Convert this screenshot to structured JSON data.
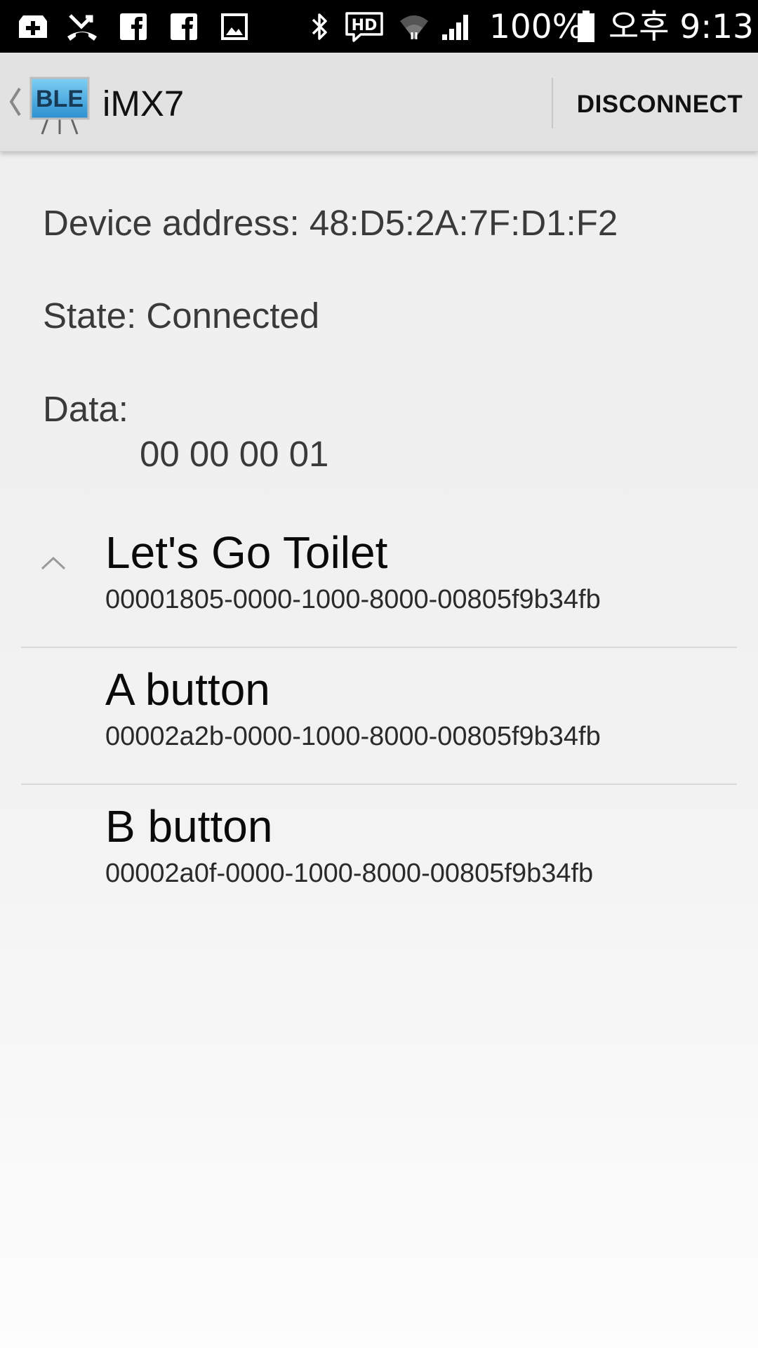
{
  "status_bar": {
    "battery_text": "100%",
    "time_text": "오후 9:13",
    "icons": [
      "add-box-icon",
      "missed-call-icon",
      "facebook-icon",
      "facebook-icon",
      "image-icon",
      "bluetooth-icon",
      "hd-voice-icon",
      "wifi-icon",
      "signal-icon",
      "battery-icon"
    ]
  },
  "action_bar": {
    "logo_text": "BLE",
    "title": "iMX7",
    "disconnect_label": "DISCONNECT"
  },
  "device": {
    "address_line": "Device address: 48:D5:2A:7F:D1:F2",
    "state_line": "State: Connected",
    "data_label": "Data:",
    "data_value": "00 00 00 01"
  },
  "services": [
    {
      "name": "Let's Go Toilet",
      "uuid": "00001805-0000-1000-8000-00805f9b34fb",
      "expanded": true
    },
    {
      "name": "A button",
      "uuid": "00002a2b-0000-1000-8000-00805f9b34fb"
    },
    {
      "name": "B button",
      "uuid": "00002a0f-0000-1000-8000-00805f9b34fb"
    }
  ],
  "colors": {
    "status_bar_bg": "#000000",
    "action_bar_bg": "#e2e2e2",
    "logo_blue": "#3fa9e4"
  }
}
